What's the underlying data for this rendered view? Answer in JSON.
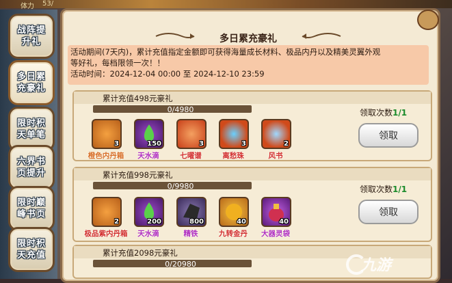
{
  "hud": {
    "label": "体力",
    "value": "53/"
  },
  "sidebar": {
    "tabs": [
      {
        "label": "战阵提升礼"
      },
      {
        "label": "多日累充豪礼"
      },
      {
        "label": "限时积天单笔"
      },
      {
        "label": "六界书页提升"
      },
      {
        "label": "限时巅峰书页"
      },
      {
        "label": "限时积天充值"
      }
    ]
  },
  "panel": {
    "title": "多日累充豪礼",
    "description_line1": "活动期间(7天内)，累计充值指定金额即可获得海量成长材料、极品内丹以及精美灵翼外观",
    "description_line2": "等好礼，每档限领一次！！",
    "time_line": "活动时间：2024-12-04 00:00 至 2024-12-10 23:59"
  },
  "rewards": [
    {
      "title": "累计充值498元豪礼",
      "progress": "0/4980",
      "claim_label": "领取次数",
      "claim_count": "1/1",
      "button": "领取",
      "items": [
        {
          "name": "橙色内丹箱",
          "count": "3",
          "icon": "treasure-chest-icon",
          "color": "#d87a2a"
        },
        {
          "name": "天水滴",
          "count": "150",
          "icon": "green-drop-icon",
          "color": "#6a2a9a"
        },
        {
          "name": "七曜谱",
          "count": "3",
          "icon": "scroll-icon",
          "color": "#e0602a"
        },
        {
          "name": "离愁珠",
          "count": "3",
          "icon": "orb-icon",
          "color": "#e0602a"
        },
        {
          "name": "风书",
          "count": "2",
          "icon": "book-icon",
          "color": "#e0602a"
        }
      ]
    },
    {
      "title": "累计充值998元豪礼",
      "progress": "0/9980",
      "claim_label": "领取次数",
      "claim_count": "1/1",
      "button": "领取",
      "items": [
        {
          "name": "极品紫内丹箱",
          "count": "2",
          "icon": "treasure-chest-icon",
          "color": "#d87a2a"
        },
        {
          "name": "天水滴",
          "count": "200",
          "icon": "green-drop-icon",
          "color": "#6a2a9a"
        },
        {
          "name": "精铁",
          "count": "800",
          "icon": "iron-ore-icon",
          "color": "#6a2a9a"
        },
        {
          "name": "九转金丹",
          "count": "40",
          "icon": "golden-pill-icon",
          "color": "#d87a2a"
        },
        {
          "name": "大器灵袋",
          "count": "40",
          "icon": "pouch-icon",
          "color": "#6a2a9a"
        }
      ]
    },
    {
      "title": "累计充值2098元豪礼",
      "progress": "0/20980"
    }
  ],
  "watermark": "九游"
}
